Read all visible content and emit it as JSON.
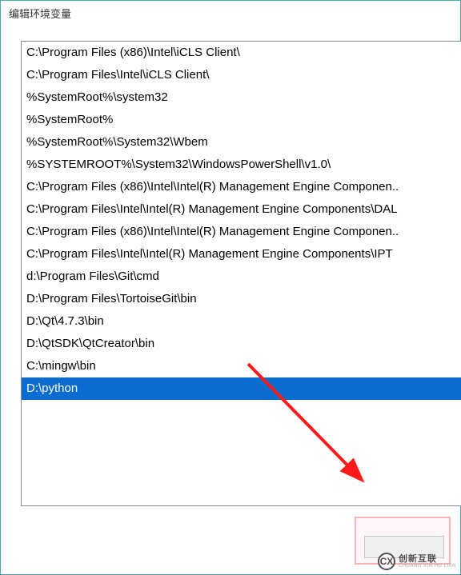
{
  "window": {
    "title": "编辑环境变量"
  },
  "paths": {
    "items": [
      "C:\\Program Files (x86)\\Intel\\iCLS Client\\",
      "C:\\Program Files\\Intel\\iCLS Client\\",
      "%SystemRoot%\\system32",
      "%SystemRoot%",
      "%SystemRoot%\\System32\\Wbem",
      "%SYSTEMROOT%\\System32\\WindowsPowerShell\\v1.0\\",
      "C:\\Program Files (x86)\\Intel\\Intel(R) Management Engine Componen..",
      "C:\\Program Files\\Intel\\Intel(R) Management Engine Components\\DAL",
      "C:\\Program Files (x86)\\Intel\\Intel(R) Management Engine Componen..",
      "C:\\Program Files\\Intel\\Intel(R) Management Engine Components\\IPT",
      "d:\\Program Files\\Git\\cmd",
      "D:\\Program Files\\TortoiseGit\\bin",
      "D:\\Qt\\4.7.3\\bin",
      "D:\\QtSDK\\QtCreator\\bin",
      "C:\\mingw\\bin",
      "D:\\python"
    ],
    "selected_index": 15
  },
  "annotation": {
    "arrow_color": "#ff1a1a",
    "highlight_color": "#f6b4b4"
  },
  "watermark": {
    "icon": "CX",
    "main": "创新互联",
    "sub": "CHUANG XIN HU LIAN"
  }
}
